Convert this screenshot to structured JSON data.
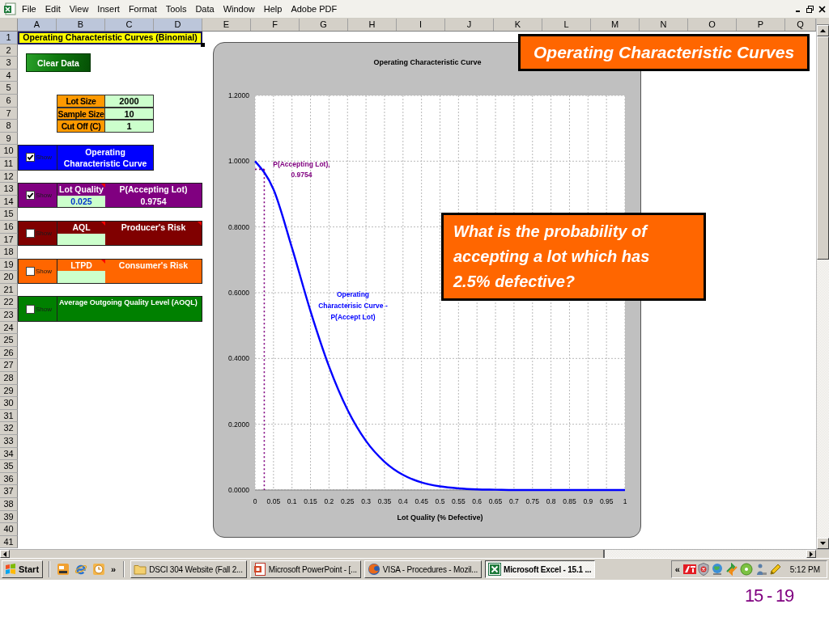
{
  "window": {
    "menu": [
      "File",
      "Edit",
      "View",
      "Insert",
      "Format",
      "Tools",
      "Data",
      "Window",
      "Help",
      "Adobe PDF"
    ]
  },
  "sheet": {
    "columns": [
      {
        "label": "A",
        "selected": true
      },
      {
        "label": "B",
        "selected": true
      },
      {
        "label": "C",
        "selected": true
      },
      {
        "label": "D",
        "selected": true
      },
      {
        "label": "E",
        "selected": false
      },
      {
        "label": "F",
        "selected": false
      },
      {
        "label": "G",
        "selected": false
      },
      {
        "label": "H",
        "selected": false
      },
      {
        "label": "I",
        "selected": false
      },
      {
        "label": "J",
        "selected": false
      },
      {
        "label": "K",
        "selected": false
      },
      {
        "label": "L",
        "selected": false
      },
      {
        "label": "M",
        "selected": false
      },
      {
        "label": "N",
        "selected": false
      },
      {
        "label": "O",
        "selected": false
      },
      {
        "label": "P",
        "selected": false
      },
      {
        "label": "Q",
        "selected": false
      }
    ],
    "rows": [
      {
        "label": "1",
        "selected": true
      },
      {
        "label": "2",
        "selected": false
      },
      {
        "label": "3",
        "selected": false
      },
      {
        "label": "4",
        "selected": false
      },
      {
        "label": "5",
        "selected": false
      },
      {
        "label": "6",
        "selected": false
      },
      {
        "label": "7",
        "selected": false
      },
      {
        "label": "8",
        "selected": false
      },
      {
        "label": "9",
        "selected": false
      },
      {
        "label": "10",
        "selected": false
      },
      {
        "label": "11",
        "selected": false
      },
      {
        "label": "12",
        "selected": false
      },
      {
        "label": "13",
        "selected": false
      },
      {
        "label": "14",
        "selected": false
      },
      {
        "label": "15",
        "selected": false
      },
      {
        "label": "16",
        "selected": false
      },
      {
        "label": "17",
        "selected": false
      },
      {
        "label": "18",
        "selected": false
      },
      {
        "label": "19",
        "selected": false
      },
      {
        "label": "20",
        "selected": false
      },
      {
        "label": "21",
        "selected": false
      },
      {
        "label": "22",
        "selected": false
      },
      {
        "label": "23",
        "selected": false
      },
      {
        "label": "24",
        "selected": false
      },
      {
        "label": "25",
        "selected": false
      },
      {
        "label": "26",
        "selected": false
      },
      {
        "label": "27",
        "selected": false
      },
      {
        "label": "28",
        "selected": false
      },
      {
        "label": "29",
        "selected": false
      },
      {
        "label": "30",
        "selected": false
      },
      {
        "label": "31",
        "selected": false
      },
      {
        "label": "32",
        "selected": false
      },
      {
        "label": "33",
        "selected": false
      },
      {
        "label": "34",
        "selected": false
      },
      {
        "label": "35",
        "selected": false
      },
      {
        "label": "36",
        "selected": false
      },
      {
        "label": "37",
        "selected": false
      },
      {
        "label": "38",
        "selected": false
      },
      {
        "label": "39",
        "selected": false
      },
      {
        "label": "40",
        "selected": false
      },
      {
        "label": "41",
        "selected": false
      }
    ],
    "title_cell": "Operating Characteristic Curves (Binomial)",
    "clear_button": "Clear Data",
    "inputs": [
      {
        "label": "Lot Size",
        "value": "2000"
      },
      {
        "label": "Sample Size",
        "value": "10"
      },
      {
        "label": "Cut Off (C)",
        "value": "1"
      }
    ],
    "panels": [
      {
        "kind": "narrow",
        "color": "#0000ff",
        "checked": true,
        "show": "Show",
        "title": "Operating Characteristic Curve"
      },
      {
        "kind": "pair",
        "color": "#800080",
        "checked": true,
        "show": "Show",
        "input_label": "Lot Quality",
        "input_value": "0.025",
        "result_label": "P(Accepting Lot)",
        "result_value": "0.9754",
        "input_comment": true,
        "result_comment": false
      },
      {
        "kind": "pair",
        "color": "#800000",
        "checked": false,
        "show": "Show",
        "input_label": "AQL",
        "result_label": "Producer's Risk",
        "input_comment": true,
        "result_comment": true
      },
      {
        "kind": "pair",
        "color": "#ff6600",
        "checked": false,
        "show": "Show",
        "input_label": "LTPD",
        "result_label": "Consumer's Risk",
        "input_comment": true,
        "result_comment": false
      },
      {
        "kind": "wide",
        "color": "#008000",
        "checked": false,
        "show": "Show",
        "title": "Average Outgoing Quality Level (AOQL)"
      }
    ],
    "chart": {
      "chart_data": {
        "type": "line",
        "title": "Operating Characteristic Curve",
        "xlabel": "Lot Quality (% Defective)",
        "x": [
          0,
          0.05,
          0.1,
          0.15,
          0.2,
          0.25,
          0.3,
          0.35,
          0.4,
          0.45,
          0.5,
          0.55,
          0.6,
          0.65,
          0.7,
          0.75,
          0.8,
          0.85,
          0.9,
          0.95,
          1
        ],
        "series": [
          {
            "name": "Operating Characterisic Curve - P(Accept Lot)",
            "color": "#0000ff",
            "values": [
              1,
              0.914,
              0.736,
              0.544,
              0.376,
              0.244,
              0.149,
              0.086,
              0.046,
              0.023,
              0.011,
              0.005,
              0.002,
              0.001,
              0,
              0,
              0,
              0,
              0,
              0,
              0
            ]
          }
        ],
        "xlim": [
          0,
          1
        ],
        "ylim": [
          0,
          1.2
        ],
        "xticks": [
          0,
          0.05,
          0.1,
          0.15,
          0.2,
          0.25,
          0.3,
          0.35,
          0.4,
          0.45,
          0.5,
          0.55,
          0.6,
          0.65,
          0.7,
          0.75,
          0.8,
          0.85,
          0.9,
          0.95,
          1
        ],
        "yticks": [
          {
            "value": 0,
            "label": "0.0000"
          },
          {
            "value": 0.2,
            "label": "0.2000"
          },
          {
            "value": 0.4,
            "label": "0.4000"
          },
          {
            "value": 0.6,
            "label": "0.6000"
          },
          {
            "value": 0.8,
            "label": "0.8000"
          },
          {
            "value": 1,
            "label": "1.0000"
          },
          {
            "value": 1.2,
            "label": "1.2000"
          }
        ],
        "grid": true,
        "ref_lines": [
          {
            "axis": "x",
            "value": 0.025,
            "color": "#800080"
          }
        ],
        "annotations": [
          {
            "x": 0.025,
            "y": 0.9754,
            "text": "P(Accepting Lot), 0.9754"
          }
        ]
      }
    }
  },
  "callouts": [
    {
      "text": "Operating Characteristic Curves"
    },
    {
      "text": "What is the probability of accepting a lot which has 2.5% defective?"
    }
  ],
  "taskbar": {
    "start": "Start",
    "quick_launch_more": "»",
    "tasks": [
      {
        "label": "DSCI 304 Website (Fall 2...",
        "kind": "folder",
        "selected": false
      },
      {
        "label": "Microsoft PowerPoint - [...",
        "kind": "presentation",
        "selected": false
      },
      {
        "label": "VISA - Procedures - Mozil...",
        "kind": "browser",
        "selected": false
      },
      {
        "label": "Microsoft Excel - 15.1 ...",
        "kind": "spreadsheet",
        "selected": true
      }
    ],
    "tray_expand": "«",
    "clock": "5:12 PM"
  },
  "slide_number": "15 - 19"
}
